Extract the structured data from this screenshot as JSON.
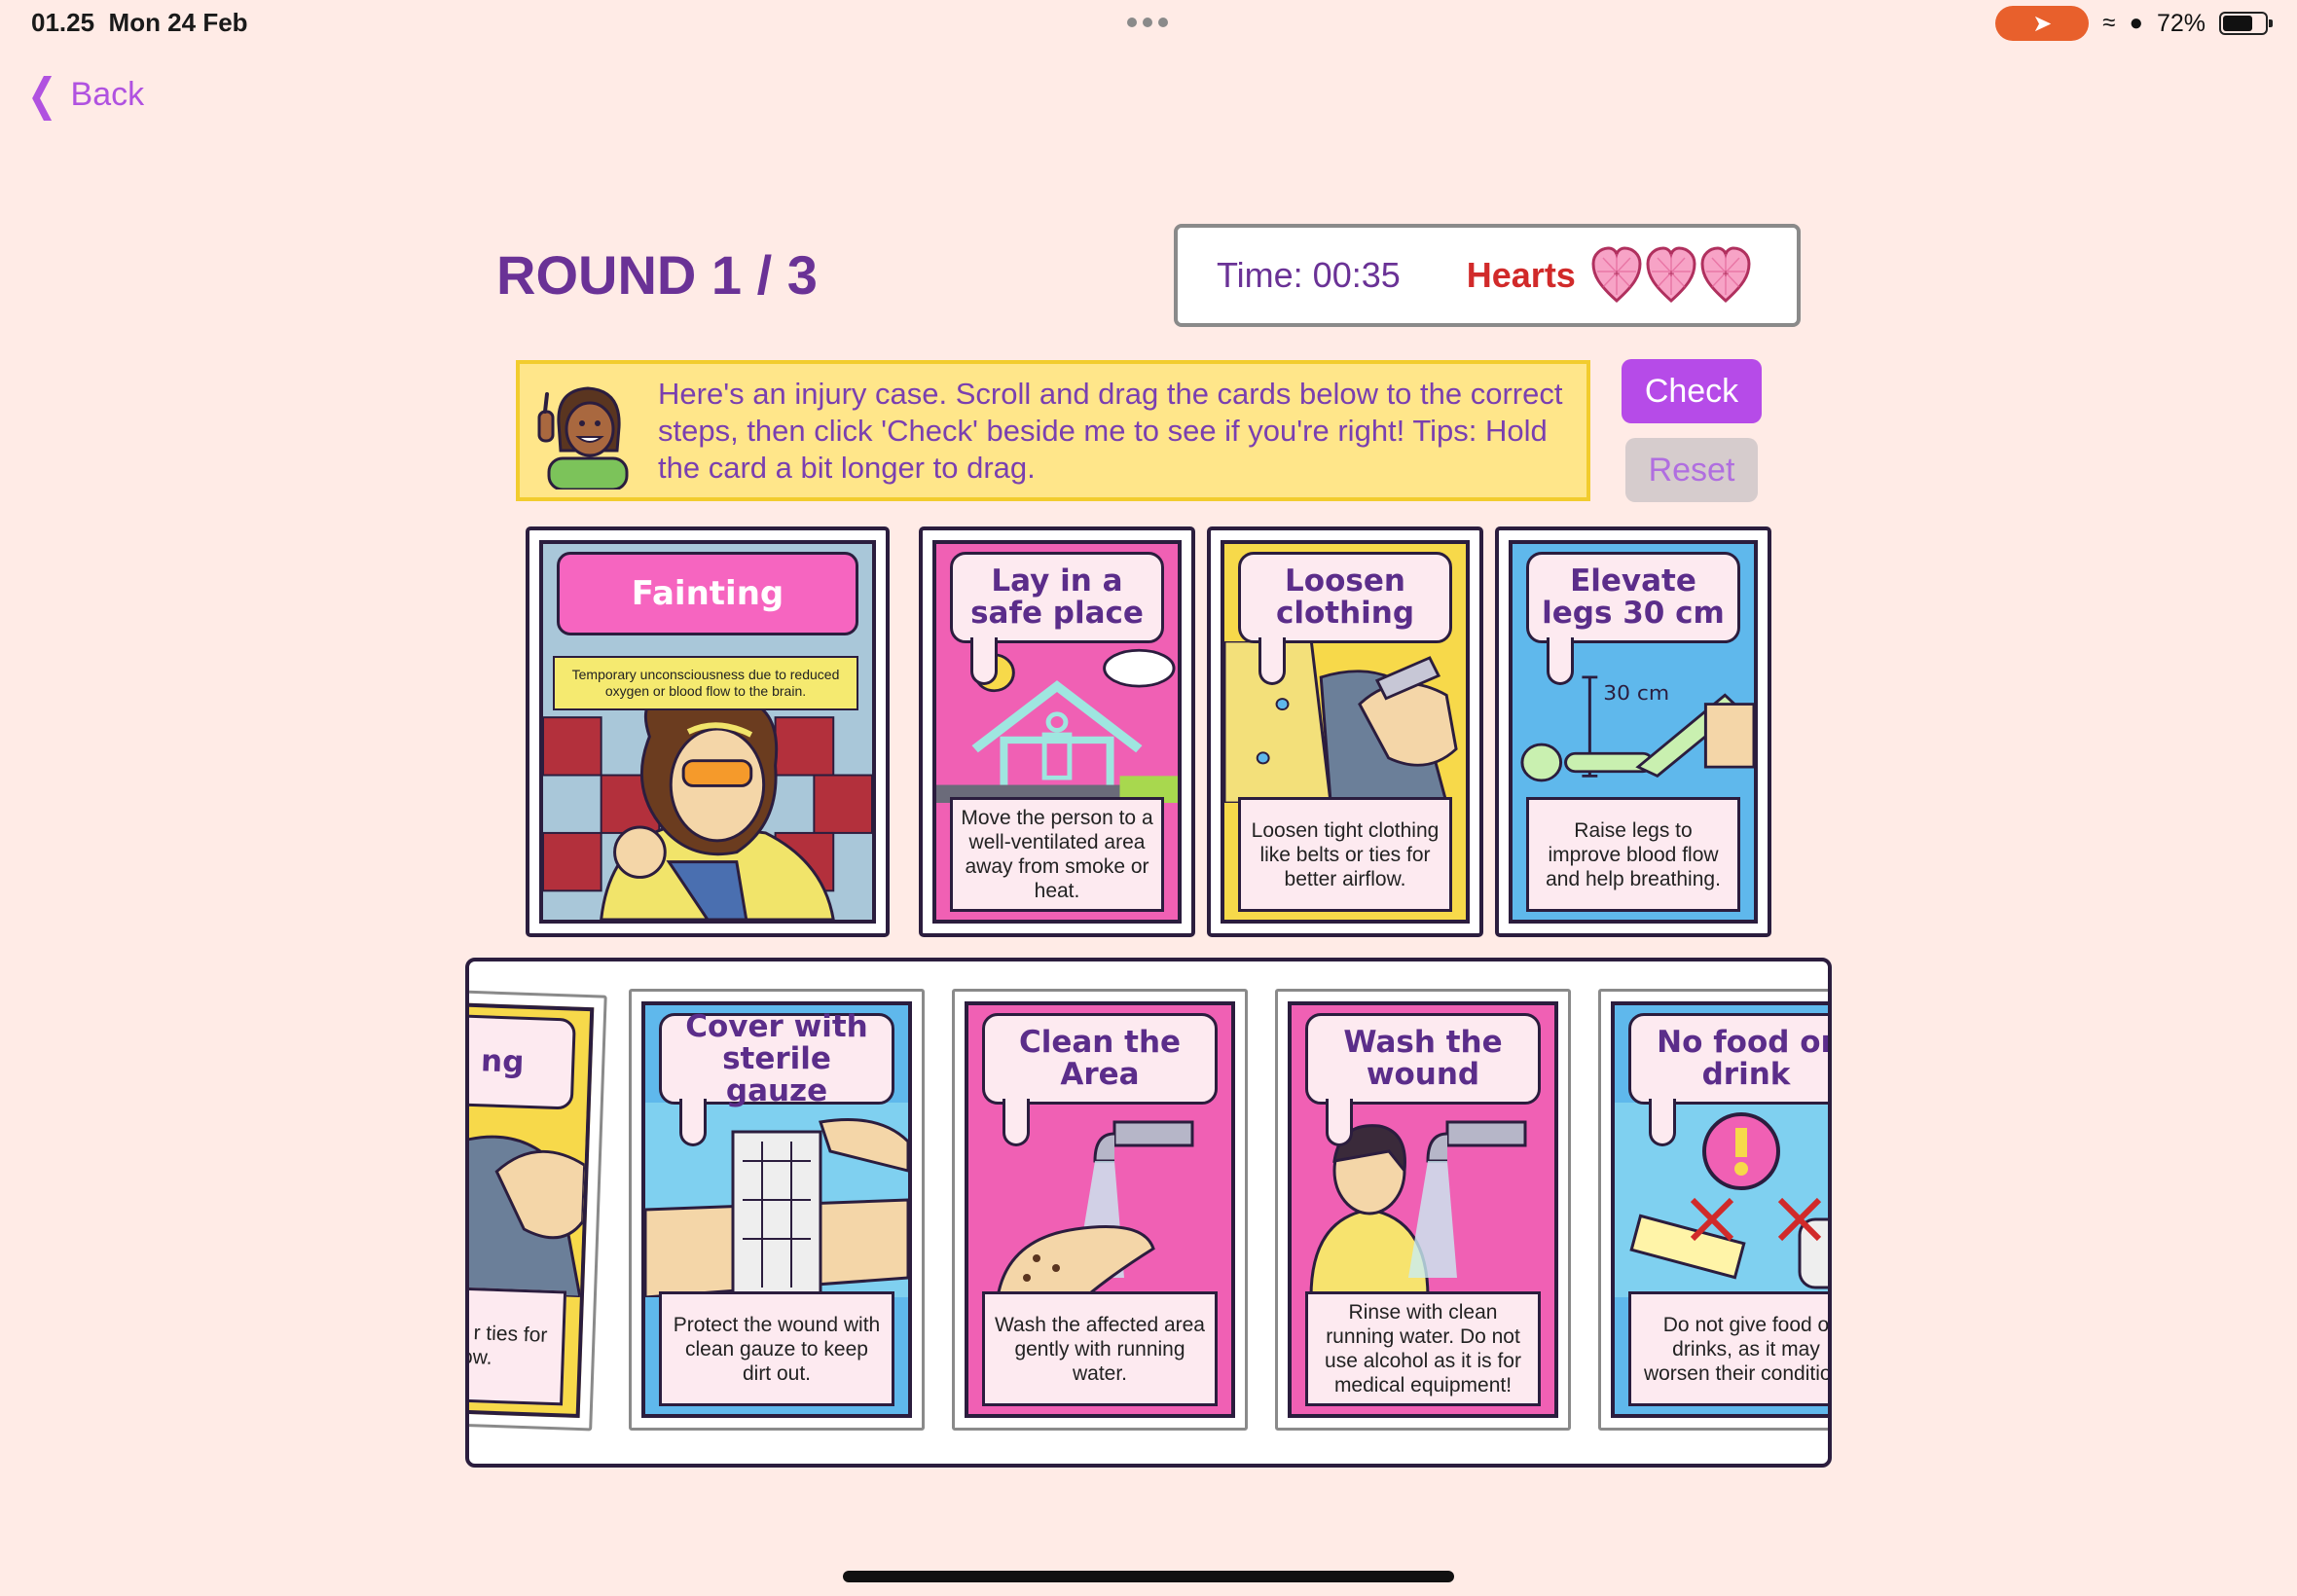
{
  "status_bar": {
    "time": "01.25",
    "date": "Mon 24 Feb",
    "battery": "72%",
    "battery_level": 0.72
  },
  "nav": {
    "back_label": "Back"
  },
  "header": {
    "round": "ROUND 1 / 3",
    "timer": "Time: 00:35",
    "hearts_label": "Hearts",
    "hearts_count": 3
  },
  "instruction": {
    "text": "Here's an injury case. Scroll and drag the cards below to the correct steps, then click 'Check' beside me to see if you're right! Tips: Hold the card a bit longer to drag."
  },
  "buttons": {
    "check": "Check",
    "reset": "Reset"
  },
  "case_card": {
    "title": "Fainting",
    "subtitle": "Temporary unconsciousness due to reduced oxygen or blood flow to the brain."
  },
  "placed_cards": [
    {
      "title": "Lay in a safe place",
      "desc": "Move the person to a well-ventilated area away from smoke or heat."
    },
    {
      "title": "Loosen clothing",
      "desc": "Loosen tight clothing like belts or ties for better airflow."
    },
    {
      "title": "Elevate legs 30 cm",
      "desc": "Raise legs to improve blood flow and help breathing.",
      "art_label": "30 cm"
    }
  ],
  "tray_cards": [
    {
      "title": "en ng",
      "desc": "t clothing r ties for irflow."
    },
    {
      "title": "Cover with sterile gauze",
      "desc": "Protect the wound with clean gauze to keep dirt out."
    },
    {
      "title": "Clean the Area",
      "desc": "Wash the affected area gently with running water."
    },
    {
      "title": "Wash the wound",
      "desc": "Rinse with clean running water. Do not use alcohol as it is for medical equipment!"
    },
    {
      "title": "No food or drink",
      "desc": "Do not give food o drinks, as it may worsen their condition."
    }
  ],
  "colors": {
    "background": "#ffebe6",
    "accent": "#b64be8",
    "title": "#6a3296",
    "hearts": "#d12a2a",
    "instruction_bg": "#ffe68a"
  }
}
